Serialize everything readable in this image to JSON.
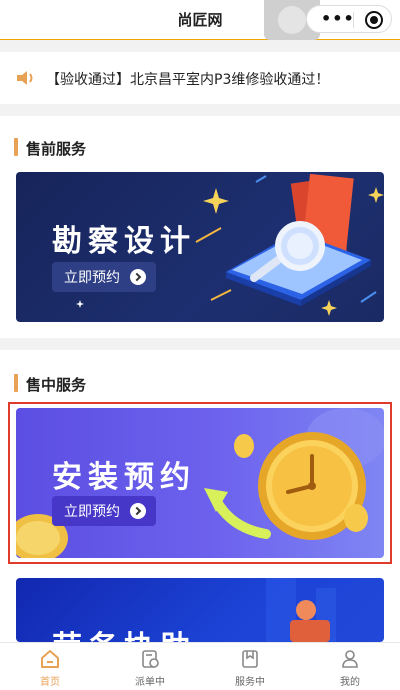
{
  "navbar": {
    "title": "尚匠网",
    "more_label": "•••"
  },
  "notice": {
    "text": "【验收通过】北京昌平室内P3维修验收通过！"
  },
  "sections": {
    "presale": {
      "title": "售前服务",
      "banner": {
        "title": "勘察设计",
        "button": "立即预约"
      }
    },
    "insale": {
      "title": "售中服务",
      "banner_install": {
        "title": "安装预约",
        "button": "立即预约"
      },
      "banner_labor": {
        "title": "劳务协助"
      }
    }
  },
  "tabbar": {
    "tabs": [
      {
        "label": "首页",
        "icon": "home-icon",
        "active": true
      },
      {
        "label": "派单中",
        "icon": "dispatch-icon",
        "active": false
      },
      {
        "label": "服务中",
        "icon": "service-icon",
        "active": false
      },
      {
        "label": "我的",
        "icon": "user-icon",
        "active": false
      }
    ]
  },
  "colors": {
    "accent": "#e8a256",
    "highlight_border": "#e03a2a"
  }
}
